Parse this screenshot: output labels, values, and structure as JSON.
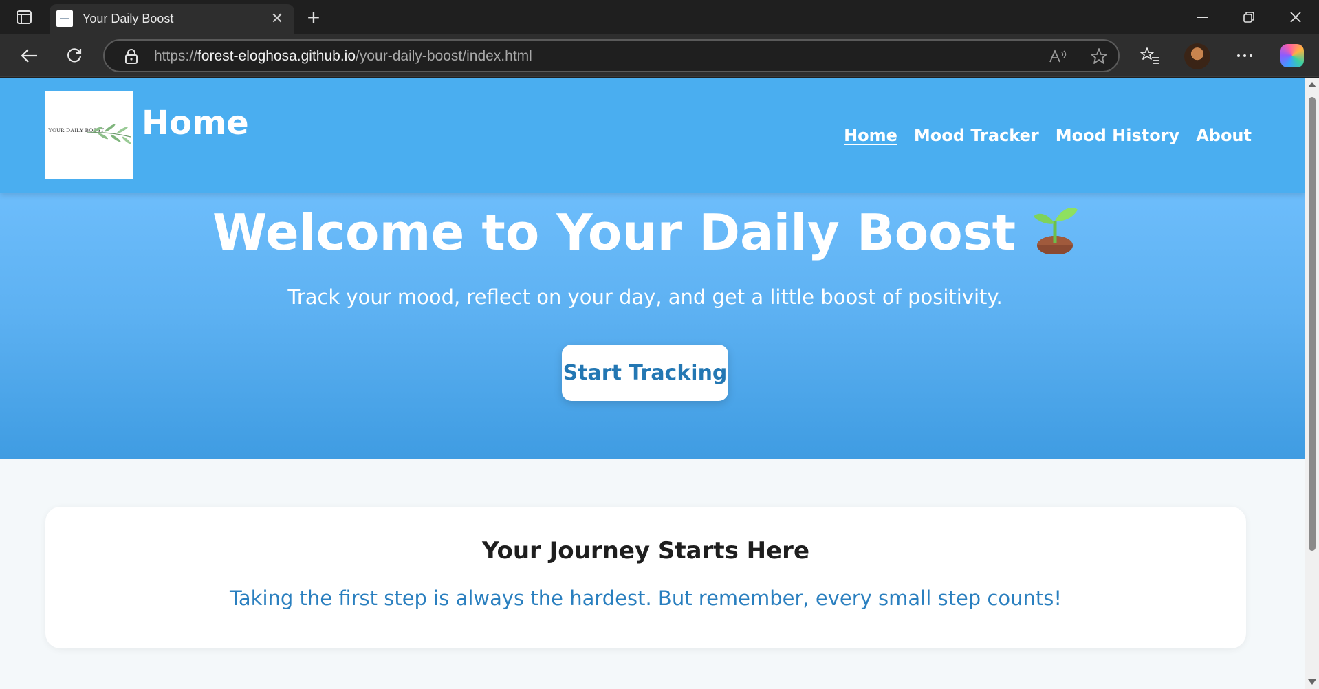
{
  "browser": {
    "tab_title": "Your Daily Boost",
    "url_scheme": "https://",
    "url_host": "forest-eloghosa.github.io",
    "url_path": "/your-daily-boost/index.html"
  },
  "header": {
    "logo_text": "YOUR DAILY BOOST",
    "title": "Home",
    "nav": [
      "Home",
      "Mood Tracker",
      "Mood History",
      "About"
    ],
    "active_nav": "Home",
    "bg_color": "#4aaef0"
  },
  "hero": {
    "title": "Welcome to Your Daily Boost",
    "title_icon": "sprout-icon",
    "subtitle": "Track your mood, reflect on your day, and get a little boost of positivity.",
    "cta_label": "Start Tracking"
  },
  "card": {
    "title": "Your Journey Starts Here",
    "text": "Taking the first step is always the hardest. But remember, every small step counts!",
    "text_color": "#2a7fbf"
  }
}
